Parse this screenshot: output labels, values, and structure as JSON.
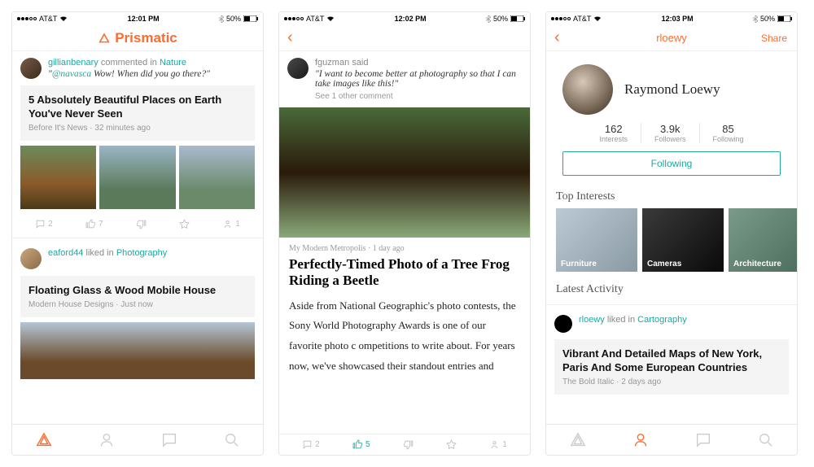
{
  "status": {
    "carrier": "AT&T",
    "times": [
      "12:01 PM",
      "12:02 PM",
      "12:03 PM"
    ],
    "battery": "50%"
  },
  "brand": "Prismatic",
  "screen1": {
    "post1": {
      "user": "gillianbenary",
      "action": "commented in",
      "topic": "Nature",
      "mention": "@navasca",
      "quote": "Wow! When did you go there?",
      "title": "5 Absolutely Beautiful Places on Earth You've Never Seen",
      "source": "Before It's News",
      "time": "32 minutes ago",
      "comments": "2",
      "likes": "7",
      "shares": "1"
    },
    "post2": {
      "user": "eaford44",
      "action": "liked in",
      "topic": "Photography",
      "title": "Floating Glass & Wood Mobile House",
      "source": "Modern House Designs",
      "time": "Just now"
    }
  },
  "screen2": {
    "user": "fguzman",
    "action": "said",
    "quote": "\"I want to become better at photography so that I can take images like this!\"",
    "see_more": "See 1 other comment",
    "source": "My Modern Metropolis",
    "time": "1 day ago",
    "title": "Perfectly-Timed Photo of a Tree Frog Riding a Beetle",
    "body": "Aside from National Geographic's photo contests, the Sony World Photography Awards is one of our favorite photo c ompetitions to write about. For years now, we've showcased their standout entries and",
    "comments": "2",
    "likes": "5",
    "shares": "1"
  },
  "screen3": {
    "nav_title": "rloewy",
    "share": "Share",
    "name": "Raymond Loewy",
    "stats": {
      "interests_val": "162",
      "interests_lbl": "Interests",
      "followers_val": "3.9k",
      "followers_lbl": "Followers",
      "following_val": "85",
      "following_lbl": "Following"
    },
    "follow_btn": "Following",
    "top_interests_hdr": "Top Interests",
    "interests": [
      "Furniture",
      "Cameras",
      "Architecture"
    ],
    "latest_hdr": "Latest Activity",
    "activity": {
      "user": "rloewy",
      "action": "liked in",
      "topic": "Cartography",
      "title": "Vibrant And Detailed Maps of New York, Paris And Some European Countries",
      "source": "The Bold Italic",
      "time": "2 days ago"
    }
  }
}
